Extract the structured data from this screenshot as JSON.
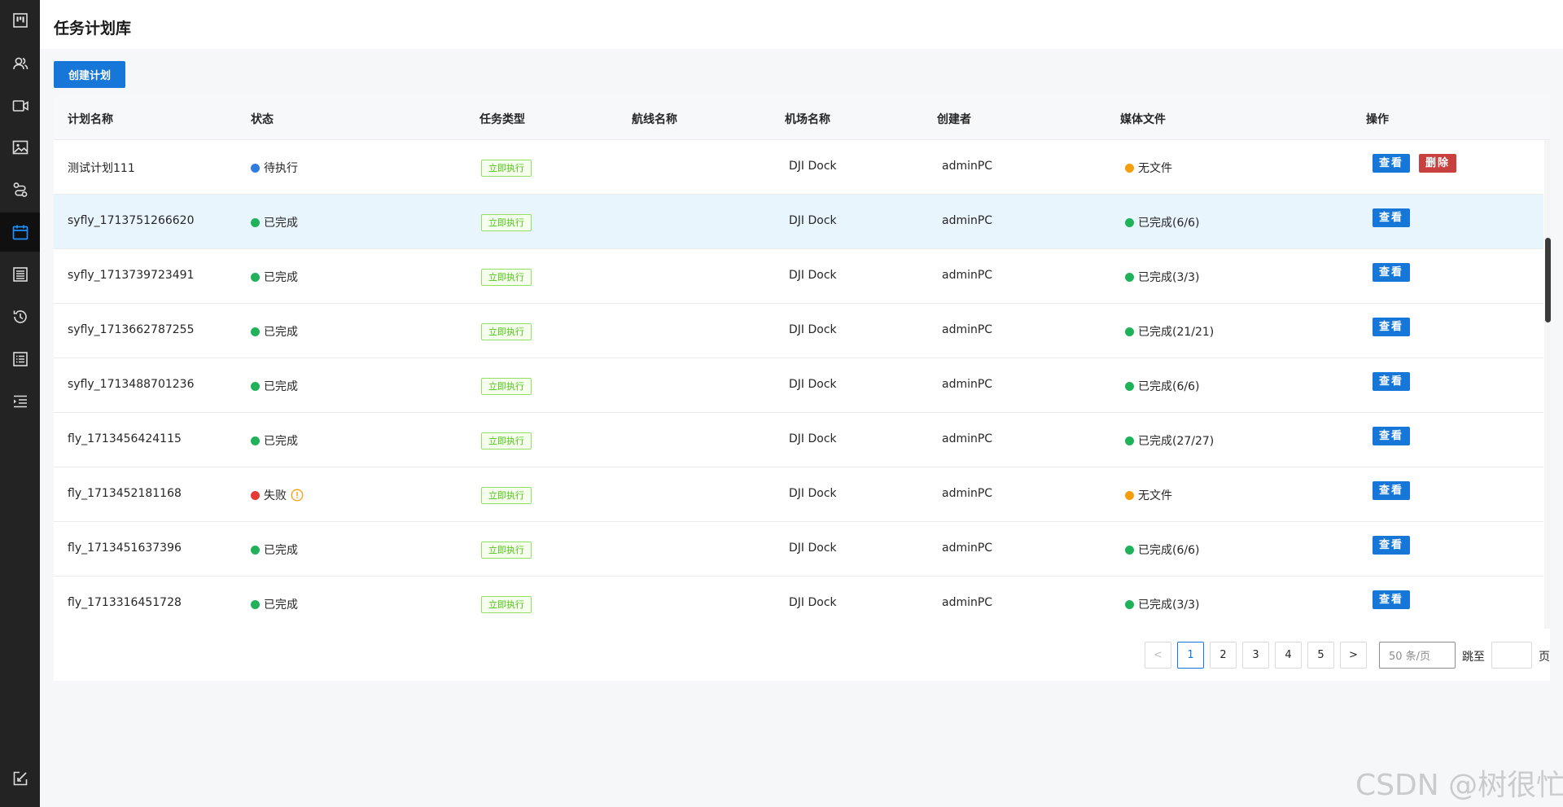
{
  "header": {
    "title": "任务计划库"
  },
  "toolbar": {
    "create_label": "创建计划"
  },
  "table": {
    "columns": [
      "计划名称",
      "状态",
      "任务类型",
      "航线名称",
      "机场名称",
      "创建者",
      "媒体文件",
      "操作"
    ],
    "rows": [
      {
        "name": "测试计划111",
        "status": "待执行",
        "task_type": "立即执行",
        "route": "",
        "dock": "DJI Dock",
        "creator": "adminPC",
        "media": "无文件",
        "view": "查看",
        "delete": "删除"
      },
      {
        "name": "syfly_1713751266620",
        "status": "已完成",
        "task_type": "立即执行",
        "route": "",
        "dock": "DJI Dock",
        "creator": "adminPC",
        "media": "已完成(6/6)",
        "view": "查看"
      },
      {
        "name": "syfly_1713739723491",
        "status": "已完成",
        "task_type": "立即执行",
        "route": "",
        "dock": "DJI Dock",
        "creator": "adminPC",
        "media": "已完成(3/3)",
        "view": "查看"
      },
      {
        "name": "syfly_1713662787255",
        "status": "已完成",
        "task_type": "立即执行",
        "route": "",
        "dock": "DJI Dock",
        "creator": "adminPC",
        "media": "已完成(21/21)",
        "view": "查看"
      },
      {
        "name": "syfly_1713488701236",
        "status": "已完成",
        "task_type": "立即执行",
        "route": "",
        "dock": "DJI Dock",
        "creator": "adminPC",
        "media": "已完成(6/6)",
        "view": "查看"
      },
      {
        "name": "fly_1713456424115",
        "status": "已完成",
        "task_type": "立即执行",
        "route": "",
        "dock": "DJI Dock",
        "creator": "adminPC",
        "media": "已完成(27/27)",
        "view": "查看"
      },
      {
        "name": "fly_1713452181168",
        "status": "失败",
        "task_type": "立即执行",
        "route": "",
        "dock": "DJI Dock",
        "creator": "adminPC",
        "media": "无文件",
        "view": "查看"
      },
      {
        "name": "fly_1713451637396",
        "status": "已完成",
        "task_type": "立即执行",
        "route": "",
        "dock": "DJI Dock",
        "creator": "adminPC",
        "media": "已完成(6/6)",
        "view": "查看"
      },
      {
        "name": "fly_1713316451728",
        "status": "已完成",
        "task_type": "立即执行",
        "route": "",
        "dock": "DJI Dock",
        "creator": "adminPC",
        "media": "已完成(3/3)",
        "view": "查看"
      }
    ]
  },
  "pagination": {
    "pages": [
      "1",
      "2",
      "3",
      "4",
      "5"
    ],
    "current": "1",
    "prev": "<",
    "next": ">",
    "page_size": "50 条/页",
    "jump_label": "跳至",
    "page_suffix": "页"
  },
  "watermark": "CSDN @树很忙",
  "colors": {
    "primary": "#1677d9",
    "danger": "#c9413e",
    "status_done": "#20b25a",
    "status_pending": "#2f7de1",
    "status_failed": "#e53935",
    "media_none": "#f59e0b",
    "sidebar_bg": "#232323",
    "row_highlight": "#e8f5fd"
  },
  "sidebar": {
    "items": [
      {
        "icon": "dashboard-icon",
        "active": false
      },
      {
        "icon": "users-icon",
        "active": false
      },
      {
        "icon": "video-icon",
        "active": false
      },
      {
        "icon": "image-icon",
        "active": false
      },
      {
        "icon": "route-icon",
        "active": false
      },
      {
        "icon": "calendar-icon",
        "active": true
      },
      {
        "icon": "building-icon",
        "active": false
      },
      {
        "icon": "history-icon",
        "active": false
      },
      {
        "icon": "list-icon",
        "active": false
      },
      {
        "icon": "menu-indent-icon",
        "active": false
      },
      {
        "icon": "edit-icon",
        "active": false
      }
    ]
  }
}
